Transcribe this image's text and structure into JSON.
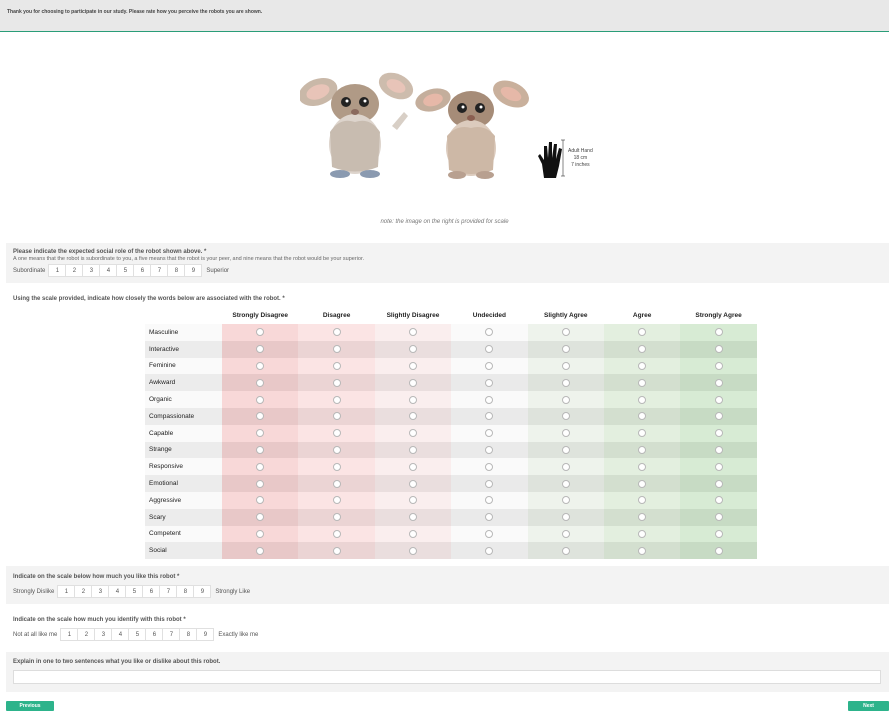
{
  "header": {
    "text": "Thank you for choosing to participate in our study. Please rate how you perceive the robots you are shown."
  },
  "figure": {
    "scale_label": [
      "Adult Hand",
      "18 cm",
      "7 inches"
    ],
    "caption": "note: the image on the right is provided for scale"
  },
  "social_role": {
    "title": "Please indicate the expected social role of the robot shown above. *",
    "subtitle": "A one means that the robot is subordinate to you, a five means that the robot is your peer, and nine means that the robot would be your superior.",
    "left": "Subordinate",
    "right": "Superior",
    "options": [
      "1",
      "2",
      "3",
      "4",
      "5",
      "6",
      "7",
      "8",
      "9"
    ]
  },
  "matrix": {
    "title": "Using the scale provided, indicate how closely the words below are associated with the robot. *",
    "columns": [
      "Strongly Disagree",
      "Disagree",
      "Slightly Disagree",
      "Undecided",
      "Slightly Agree",
      "Agree",
      "Strongly Agree"
    ],
    "rows": [
      "Masculine",
      "Interactive",
      "Feminine",
      "Awkward",
      "Organic",
      "Compassionate",
      "Capable",
      "Strange",
      "Responsive",
      "Emotional",
      "Aggressive",
      "Scary",
      "Competent",
      "Social"
    ],
    "column_colors": [
      "#f8d8d8",
      "#fbe4e4",
      "#faeeee",
      "#fafafa",
      "#eef3ec",
      "#e3efdf",
      "#d7ebd4"
    ],
    "column_colors_alt": [
      "#e8c8c8",
      "#ebd4d4",
      "#eadede",
      "#eaeaea",
      "#dee3dc",
      "#d3dfcf",
      "#c7dbc4"
    ]
  },
  "like": {
    "title": "Indicate on the scale below how much you like this robot *",
    "left": "Strongly Dislike",
    "right": "Strongly Like",
    "options": [
      "1",
      "2",
      "3",
      "4",
      "5",
      "6",
      "7",
      "8",
      "9"
    ]
  },
  "identify": {
    "title": "Indicate on the scale how much you identify with this robot *",
    "left": "Not at all like me",
    "right": "Exactly like me",
    "options": [
      "1",
      "2",
      "3",
      "4",
      "5",
      "6",
      "7",
      "8",
      "9"
    ]
  },
  "explain": {
    "title": "Explain in one to two sentences what you like or dislike about this robot.",
    "value": ""
  },
  "nav": {
    "previous": "Previous",
    "next": "Next"
  }
}
